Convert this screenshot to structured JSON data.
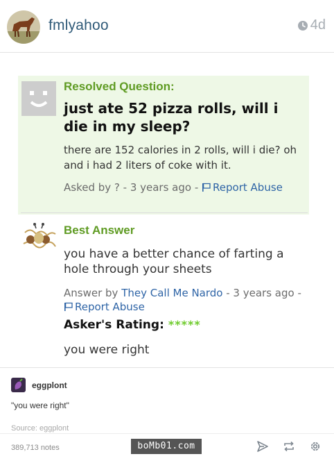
{
  "header": {
    "username": "fmlyahoo",
    "time": "4d"
  },
  "question_card": {
    "status_label": "Resolved Question:",
    "question": "just ate 52 pizza rolls, will i die in my sleep?",
    "details": "there are 152 calories in 2 rolls, will i die? oh and i had 2 liters of coke with it.",
    "asked_prefix": "Asked by ? - 3 years ago -",
    "report_abuse": "Report Abuse"
  },
  "answer_card": {
    "label": "Best Answer",
    "answer": "you have a better chance of farting a hole through your sheets",
    "answer_prefix": "Answer by",
    "answerer": "They Call Me Nardo",
    "answer_time": "- 3 years ago -",
    "report_abuse": "Report Abuse",
    "rating_label": "Asker's Rating:",
    "rating_stars": "*****",
    "comment": "you were right"
  },
  "reblog": {
    "username": "eggplont",
    "text": "\"you were right\"",
    "source": "Source: eggplont"
  },
  "footer": {
    "notes": "389,713 notes",
    "watermark": "boMb01.com"
  },
  "colors": {
    "accent_green": "#5f9b23",
    "link_blue": "#2e64a6",
    "username_blue": "#2f5a78"
  }
}
